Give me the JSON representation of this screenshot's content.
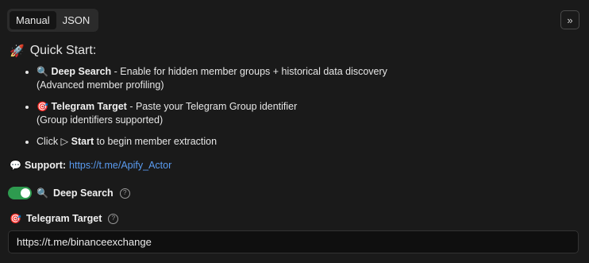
{
  "tabs": {
    "manual": "Manual",
    "json": "JSON",
    "active": "Manual"
  },
  "collapse_glyph": "»",
  "quick_start": {
    "rocket": "🚀",
    "title": "Quick Start:",
    "items": [
      {
        "icon": "🔍",
        "bold": "Deep Search",
        "text": " - Enable for hidden member groups + historical data discovery",
        "subtext": "(Advanced member profiling)"
      },
      {
        "icon": "🎯",
        "bold": "Telegram Target",
        "text": " - Paste your Telegram Group identifier",
        "subtext": "(Group identifiers supported)"
      },
      {
        "prefix": "Click ▷ ",
        "bold": "Start",
        "text": " to begin member extraction"
      }
    ]
  },
  "support": {
    "icon": "💬",
    "label": "Support:",
    "link": "https://t.me/Apify_Actor"
  },
  "deep_search": {
    "icon": "🔍",
    "label": "Deep Search",
    "enabled": true,
    "accent": "#2e9b4f"
  },
  "telegram_target": {
    "icon": "🎯",
    "label": "Telegram Target",
    "value": "https://t.me/binanceexchange"
  },
  "help_glyph": "?"
}
